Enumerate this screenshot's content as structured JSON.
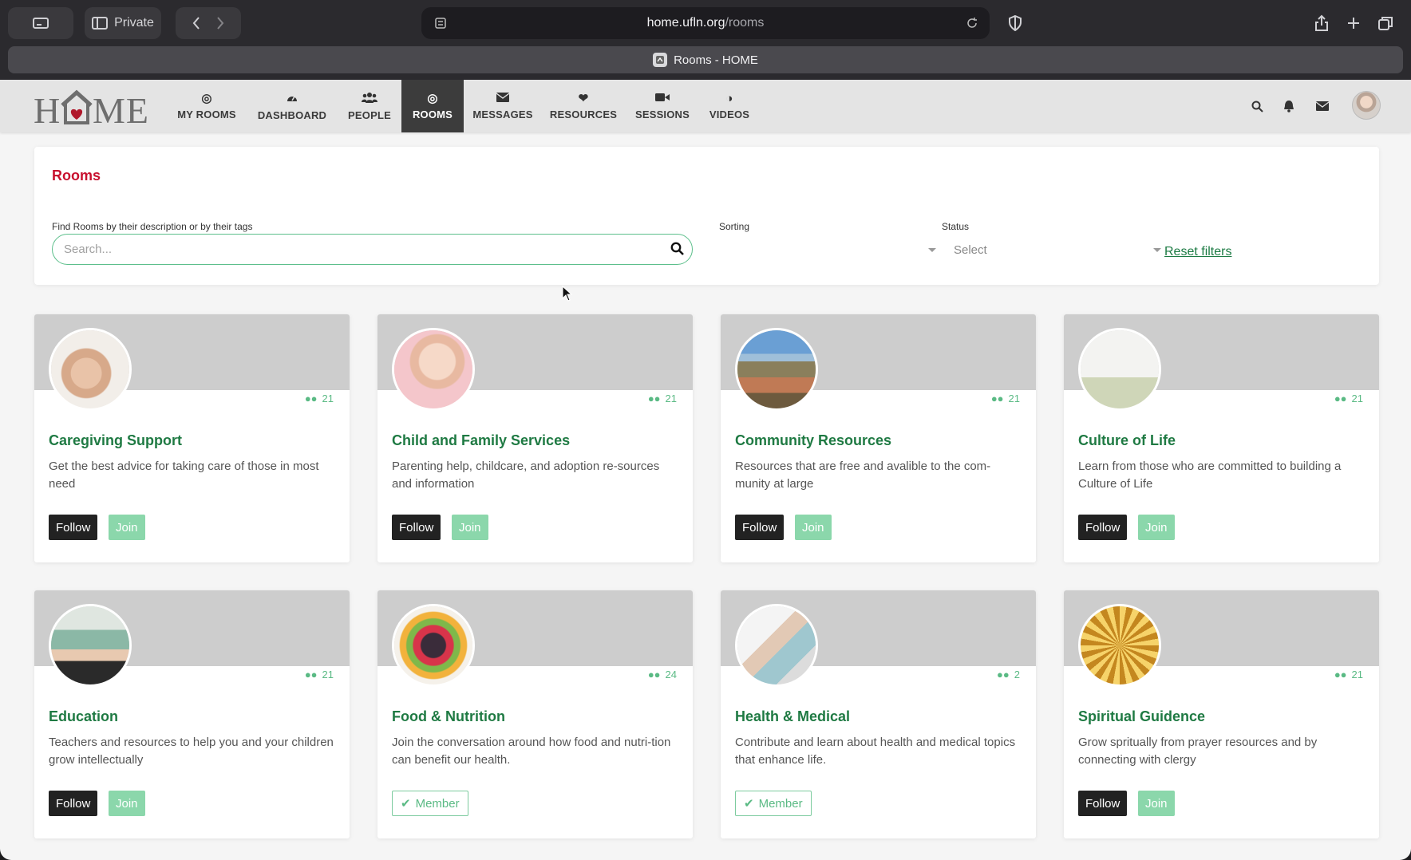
{
  "browser": {
    "private_label": "Private",
    "url_host": "home.ufln.org",
    "url_path": "/rooms",
    "tab_title": "Rooms - HOME"
  },
  "nav": {
    "logo_text": "HOME",
    "items": [
      {
        "label": "MY ROOMS",
        "icon": "target-icon"
      },
      {
        "label": "DASHBOARD",
        "icon": "dashboard-icon"
      },
      {
        "label": "PEOPLE",
        "icon": "people-icon"
      },
      {
        "label": "ROOMS",
        "icon": "target-icon",
        "active": true
      },
      {
        "label": "MESSAGES",
        "icon": "envelope-icon"
      },
      {
        "label": "RESOURCES",
        "icon": "heart-icon"
      },
      {
        "label": "SESSIONS",
        "icon": "video-camera-icon"
      },
      {
        "label": "VIDEOS",
        "icon": "half-circle-icon"
      }
    ]
  },
  "filters": {
    "title": "Rooms",
    "search_label": "Find Rooms by their description or by their tags",
    "search_placeholder": "Search...",
    "sorting_label": "Sorting",
    "sorting_value": "",
    "status_label": "Status",
    "status_value": "Select",
    "reset_label": "Reset filters"
  },
  "buttons": {
    "follow": "Follow",
    "join": "Join",
    "member": "Member"
  },
  "rooms": [
    {
      "title": "Caregiving Support",
      "desc": "Get the best advice for taking care of those in most need",
      "members": "21",
      "state": "open"
    },
    {
      "title": "Child and Family Services",
      "desc": "Parenting help, childcare, and adoption re-sources and information",
      "members": "21",
      "state": "open"
    },
    {
      "title": "Community Resources",
      "desc": "Resources that are free and avalible to the com-munity at large",
      "members": "21",
      "state": "open"
    },
    {
      "title": "Culture of Life",
      "desc": "Learn from those who are committed to building a Culture of Life",
      "members": "21",
      "state": "open"
    },
    {
      "title": "Education",
      "desc": "Teachers and resources to help you and your children grow intellectually",
      "members": "21",
      "state": "open"
    },
    {
      "title": "Food & Nutrition",
      "desc": "Join the conversation around how food and nutri-tion can benefit our health.",
      "members": "24",
      "state": "member"
    },
    {
      "title": "Health & Medical",
      "desc": "Contribute and learn about health and medical topics that enhance life.",
      "members": "2",
      "state": "member"
    },
    {
      "title": "Spiritual Guidence",
      "desc": "Grow spritually from prayer resources and by connecting with clergy",
      "members": "21",
      "state": "open"
    }
  ],
  "colors": {
    "accent_green": "#1f7a43",
    "join_green": "#8bd7ab",
    "title_red": "#c8102e",
    "active_nav": "#3c3c3c"
  }
}
